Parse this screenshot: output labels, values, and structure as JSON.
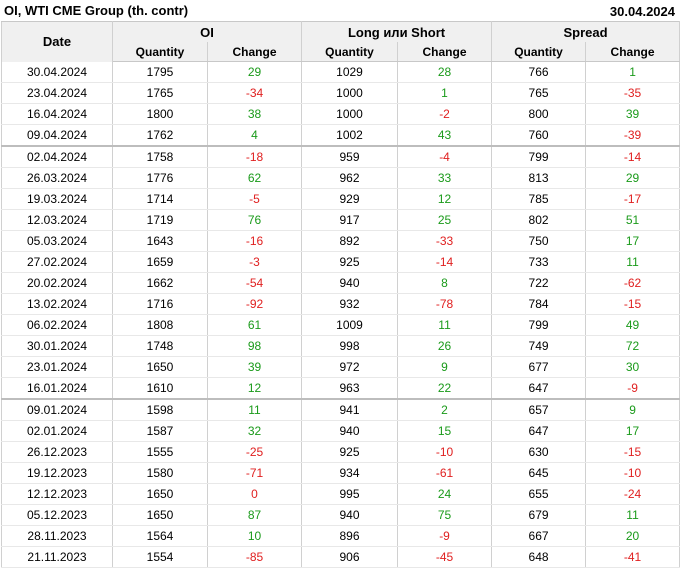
{
  "header": {
    "title": "OI, WTI CME Group (th. contr)",
    "date": "30.04.2024"
  },
  "table": {
    "date_header": "Date",
    "groups": [
      "OI",
      "Long или Short",
      "Spread"
    ],
    "subheaders": [
      "Quantity",
      "Change",
      "Quantity",
      "Change",
      "Quantity",
      "Change"
    ],
    "rows": [
      {
        "date": "30.04.2024",
        "oi_q": "1795",
        "oi_c": "29",
        "ls_q": "1029",
        "ls_c": "28",
        "sp_q": "766",
        "sp_c": "1",
        "sep": false
      },
      {
        "date": "23.04.2024",
        "oi_q": "1765",
        "oi_c": "-34",
        "ls_q": "1000",
        "ls_c": "1",
        "sp_q": "765",
        "sp_c": "-35",
        "sep": false
      },
      {
        "date": "16.04.2024",
        "oi_q": "1800",
        "oi_c": "38",
        "ls_q": "1000",
        "ls_c": "-2",
        "sp_q": "800",
        "sp_c": "39",
        "sep": false
      },
      {
        "date": "09.04.2024",
        "oi_q": "1762",
        "oi_c": "4",
        "ls_q": "1002",
        "ls_c": "43",
        "sp_q": "760",
        "sp_c": "-39",
        "sep": false
      },
      {
        "date": "02.04.2024",
        "oi_q": "1758",
        "oi_c": "-18",
        "ls_q": "959",
        "ls_c": "-4",
        "sp_q": "799",
        "sp_c": "-14",
        "sep": true
      },
      {
        "date": "26.03.2024",
        "oi_q": "1776",
        "oi_c": "62",
        "ls_q": "962",
        "ls_c": "33",
        "sp_q": "813",
        "sp_c": "29",
        "sep": false
      },
      {
        "date": "19.03.2024",
        "oi_q": "1714",
        "oi_c": "-5",
        "ls_q": "929",
        "ls_c": "12",
        "sp_q": "785",
        "sp_c": "-17",
        "sep": false
      },
      {
        "date": "12.03.2024",
        "oi_q": "1719",
        "oi_c": "76",
        "ls_q": "917",
        "ls_c": "25",
        "sp_q": "802",
        "sp_c": "51",
        "sep": false
      },
      {
        "date": "05.03.2024",
        "oi_q": "1643",
        "oi_c": "-16",
        "ls_q": "892",
        "ls_c": "-33",
        "sp_q": "750",
        "sp_c": "17",
        "sep": false
      },
      {
        "date": "27.02.2024",
        "oi_q": "1659",
        "oi_c": "-3",
        "ls_q": "925",
        "ls_c": "-14",
        "sp_q": "733",
        "sp_c": "11",
        "sep": false
      },
      {
        "date": "20.02.2024",
        "oi_q": "1662",
        "oi_c": "-54",
        "ls_q": "940",
        "ls_c": "8",
        "sp_q": "722",
        "sp_c": "-62",
        "sep": false
      },
      {
        "date": "13.02.2024",
        "oi_q": "1716",
        "oi_c": "-92",
        "ls_q": "932",
        "ls_c": "-78",
        "sp_q": "784",
        "sp_c": "-15",
        "sep": false
      },
      {
        "date": "06.02.2024",
        "oi_q": "1808",
        "oi_c": "61",
        "ls_q": "1009",
        "ls_c": "11",
        "sp_q": "799",
        "sp_c": "49",
        "sep": false
      },
      {
        "date": "30.01.2024",
        "oi_q": "1748",
        "oi_c": "98",
        "ls_q": "998",
        "ls_c": "26",
        "sp_q": "749",
        "sp_c": "72",
        "sep": false
      },
      {
        "date": "23.01.2024",
        "oi_q": "1650",
        "oi_c": "39",
        "ls_q": "972",
        "ls_c": "9",
        "sp_q": "677",
        "sp_c": "30",
        "sep": false
      },
      {
        "date": "16.01.2024",
        "oi_q": "1610",
        "oi_c": "12",
        "ls_q": "963",
        "ls_c": "22",
        "sp_q": "647",
        "sp_c": "-9",
        "sep": false
      },
      {
        "date": "09.01.2024",
        "oi_q": "1598",
        "oi_c": "11",
        "ls_q": "941",
        "ls_c": "2",
        "sp_q": "657",
        "sp_c": "9",
        "sep": true
      },
      {
        "date": "02.01.2024",
        "oi_q": "1587",
        "oi_c": "32",
        "ls_q": "940",
        "ls_c": "15",
        "sp_q": "647",
        "sp_c": "17",
        "sep": false
      },
      {
        "date": "26.12.2023",
        "oi_q": "1555",
        "oi_c": "-25",
        "ls_q": "925",
        "ls_c": "-10",
        "sp_q": "630",
        "sp_c": "-15",
        "sep": false
      },
      {
        "date": "19.12.2023",
        "oi_q": "1580",
        "oi_c": "-71",
        "ls_q": "934",
        "ls_c": "-61",
        "sp_q": "645",
        "sp_c": "-10",
        "sep": false
      },
      {
        "date": "12.12.2023",
        "oi_q": "1650",
        "oi_c": "0",
        "ls_q": "995",
        "ls_c": "24",
        "sp_q": "655",
        "sp_c": "-24",
        "sep": false
      },
      {
        "date": "05.12.2023",
        "oi_q": "1650",
        "oi_c": "87",
        "ls_q": "940",
        "ls_c": "75",
        "sp_q": "679",
        "sp_c": "11",
        "sep": false
      },
      {
        "date": "28.11.2023",
        "oi_q": "1564",
        "oi_c": "10",
        "ls_q": "896",
        "ls_c": "-9",
        "sp_q": "667",
        "sp_c": "20",
        "sep": false
      },
      {
        "date": "21.11.2023",
        "oi_q": "1554",
        "oi_c": "-85",
        "ls_q": "906",
        "ls_c": "-45",
        "sp_q": "648",
        "sp_c": "-41",
        "sep": false
      }
    ]
  },
  "colors": {
    "positive": "#1a9a1a",
    "negative": "#e02020",
    "header_bg": "#f0f0f0"
  }
}
